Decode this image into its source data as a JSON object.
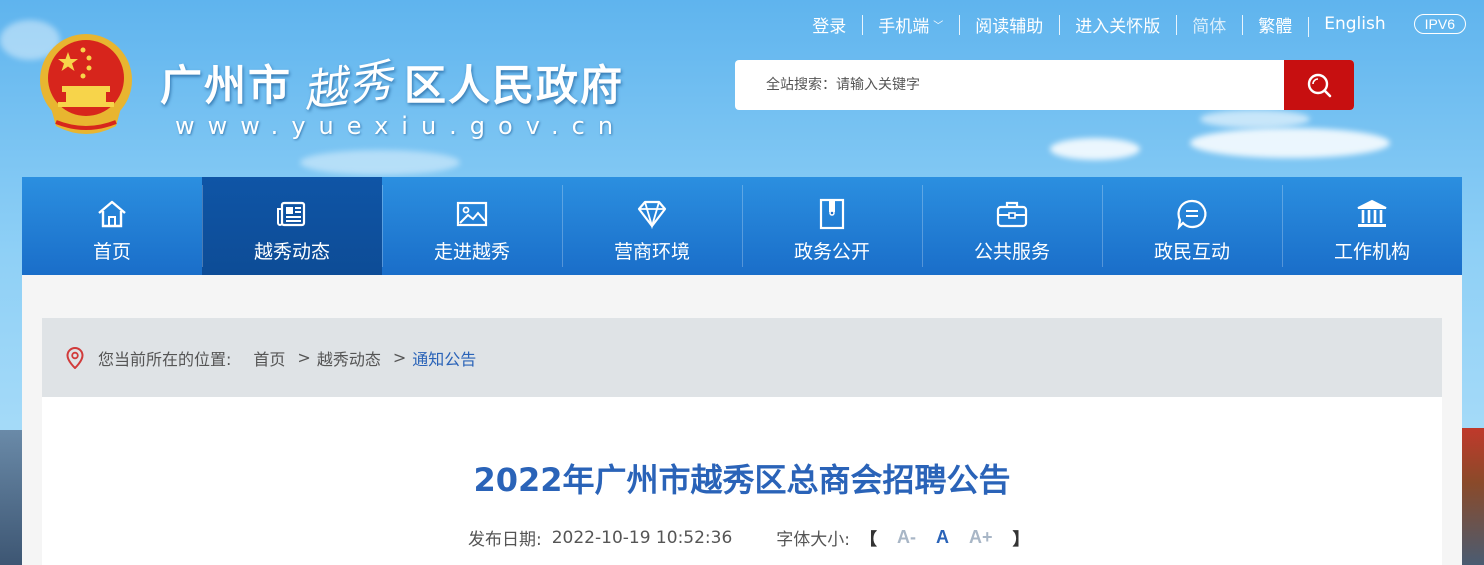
{
  "header": {
    "site_name_prefix": "广州市",
    "site_name_calligraphy": "越秀",
    "site_name_suffix": "区人民政府",
    "site_url": "www.yuexiu.gov.cn"
  },
  "topbar": {
    "login": "登录",
    "mobile": "手机端",
    "reading_aid": "阅读辅助",
    "care_version": "进入关怀版",
    "simplified": "简体",
    "traditional": "繁體",
    "english": "English",
    "ipv6": "IPV6"
  },
  "search": {
    "placeholder": "全站搜索：请输入关键字"
  },
  "nav": {
    "items": [
      {
        "label": "首页"
      },
      {
        "label": "越秀动态"
      },
      {
        "label": "走进越秀"
      },
      {
        "label": "营商环境"
      },
      {
        "label": "政务公开"
      },
      {
        "label": "公共服务"
      },
      {
        "label": "政民互动"
      },
      {
        "label": "工作机构"
      }
    ],
    "active_index": 1
  },
  "breadcrumb": {
    "lead": "您当前所在的位置:",
    "items": [
      "首页",
      "越秀动态",
      "通知公告"
    ]
  },
  "article": {
    "title": "2022年广州市越秀区总商会招聘公告",
    "date_label": "发布日期:",
    "date_value": "2022-10-19 10:52:36",
    "font_size_label": "字体大小:",
    "font_small": "A-",
    "font_mid": "A",
    "font_large": "A+",
    "bracket_open": "【",
    "bracket_close": "】"
  },
  "colors": {
    "nav_bg": "#1a6ec9",
    "nav_active": "#0d4c96",
    "search_button": "#c70f10",
    "title": "#2a63b8"
  }
}
